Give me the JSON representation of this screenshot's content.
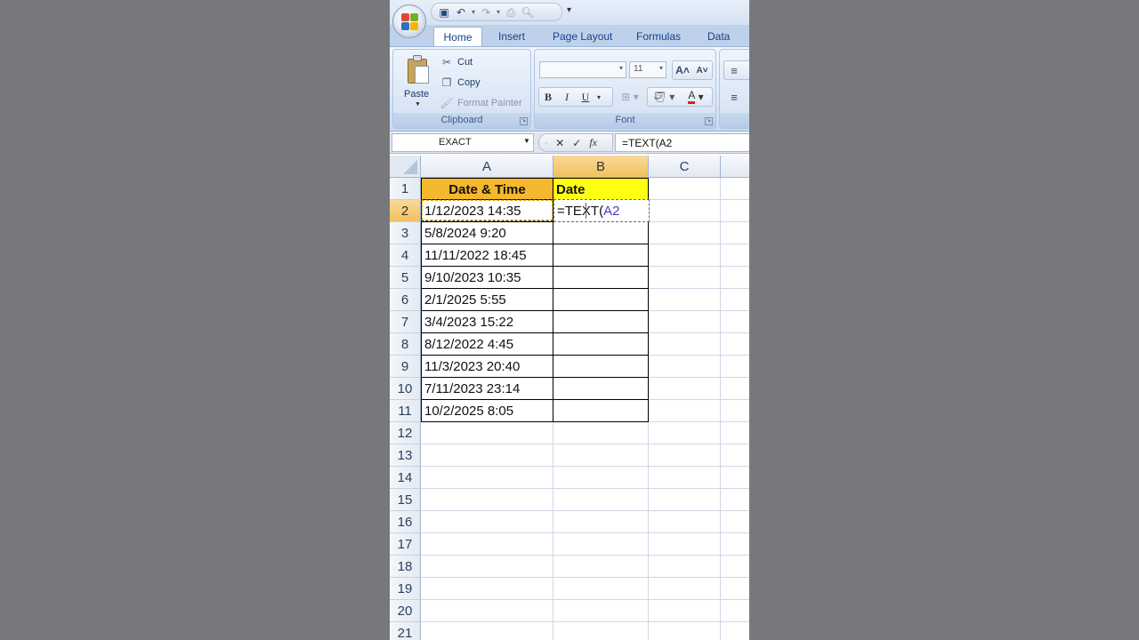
{
  "qat": {
    "more_label": "▾"
  },
  "ribbon": {
    "tabs": [
      "Home",
      "Insert",
      "Page Layout",
      "Formulas",
      "Data"
    ],
    "clipboard": {
      "group_label": "Clipboard",
      "paste": "Paste",
      "cut": "Cut",
      "copy": "Copy",
      "format_painter": "Format Painter"
    },
    "font": {
      "group_label": "Font",
      "font_name": "",
      "font_size": "11",
      "bold": "B",
      "italic": "I",
      "underline": "U"
    }
  },
  "formula_bar": {
    "name_box": "EXACT",
    "formula": "=TEXT(A2"
  },
  "grid": {
    "columns": [
      "A",
      "B",
      "C"
    ],
    "row_numbers": [
      "1",
      "2",
      "3",
      "4",
      "5",
      "6",
      "7",
      "8",
      "9",
      "10",
      "11",
      "12",
      "13",
      "14",
      "15",
      "16",
      "17",
      "18",
      "19",
      "20",
      "21"
    ],
    "header_a": "Date & Time",
    "header_b": "Date",
    "values_a": [
      "1/12/2023 14:35",
      "5/8/2024 9:20",
      "11/11/2022 18:45",
      "9/10/2023 10:35",
      "2/1/2025 5:55",
      "3/4/2023 15:22",
      "8/12/2022 4:45",
      "11/3/2023 20:40",
      "7/11/2023 23:14",
      "10/2/2025 8:05"
    ],
    "edit_cell": {
      "prefix": "=TEXT(",
      "ref": "A2"
    }
  },
  "colors": {
    "header_a_fill": "#f5b72c",
    "header_b_fill": "#ffff14",
    "reference_color": "#4a3cc7",
    "ribbon_tab_text": "#15428b"
  }
}
